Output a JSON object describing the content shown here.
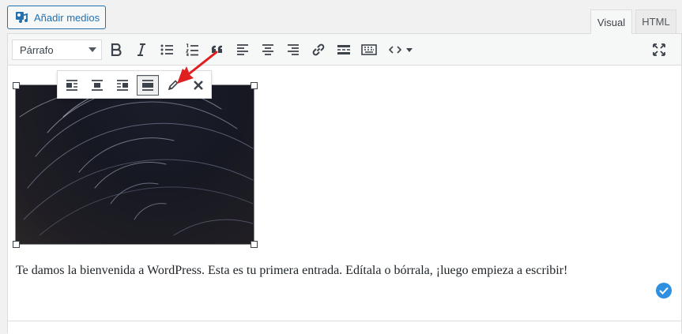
{
  "header": {
    "add_media_label": "Añadir medios",
    "tabs": [
      {
        "label": "Visual",
        "active": true
      },
      {
        "label": "HTML",
        "active": false
      }
    ]
  },
  "toolbar": {
    "format_value": "Párrafo",
    "buttons": [
      {
        "name": "bold-button",
        "icon": "bold-icon"
      },
      {
        "name": "italic-button",
        "icon": "italic-icon"
      },
      {
        "name": "bulleted-list-button",
        "icon": "bulleted-list-icon"
      },
      {
        "name": "numbered-list-button",
        "icon": "numbered-list-icon"
      },
      {
        "name": "blockquote-button",
        "icon": "blockquote-icon"
      },
      {
        "name": "align-left-button",
        "icon": "align-left-icon"
      },
      {
        "name": "align-center-button",
        "icon": "align-center-icon"
      },
      {
        "name": "align-right-button",
        "icon": "align-right-icon"
      },
      {
        "name": "insert-link-button",
        "icon": "link-icon"
      },
      {
        "name": "read-more-button",
        "icon": "read-more-icon"
      },
      {
        "name": "toolbar-toggle-button",
        "icon": "keyboard-icon"
      },
      {
        "name": "code-button",
        "icon": "code-icon"
      },
      {
        "name": "fullscreen-button",
        "icon": "fullscreen-icon"
      }
    ]
  },
  "image_toolbar": {
    "buttons": [
      {
        "name": "align-left-image-button",
        "icon": "image-align-left-icon",
        "active": false
      },
      {
        "name": "align-center-image-button",
        "icon": "image-align-center-icon",
        "active": false
      },
      {
        "name": "align-right-image-button",
        "icon": "image-align-right-icon",
        "active": false
      },
      {
        "name": "no-align-image-button",
        "icon": "image-no-align-icon",
        "active": true
      },
      {
        "name": "edit-image-button",
        "icon": "pencil-icon",
        "active": false
      },
      {
        "name": "remove-image-button",
        "icon": "close-icon",
        "active": false
      }
    ]
  },
  "content": {
    "paragraph": "Te damos la bienvenida a WordPress. Esta es tu primera entrada. Edítala o bórrala, ¡luego empieza a escribir!"
  },
  "colors": {
    "accent": "#2271b1",
    "annotation_arrow": "#e02020",
    "check_badge": "#2f8fe0"
  }
}
